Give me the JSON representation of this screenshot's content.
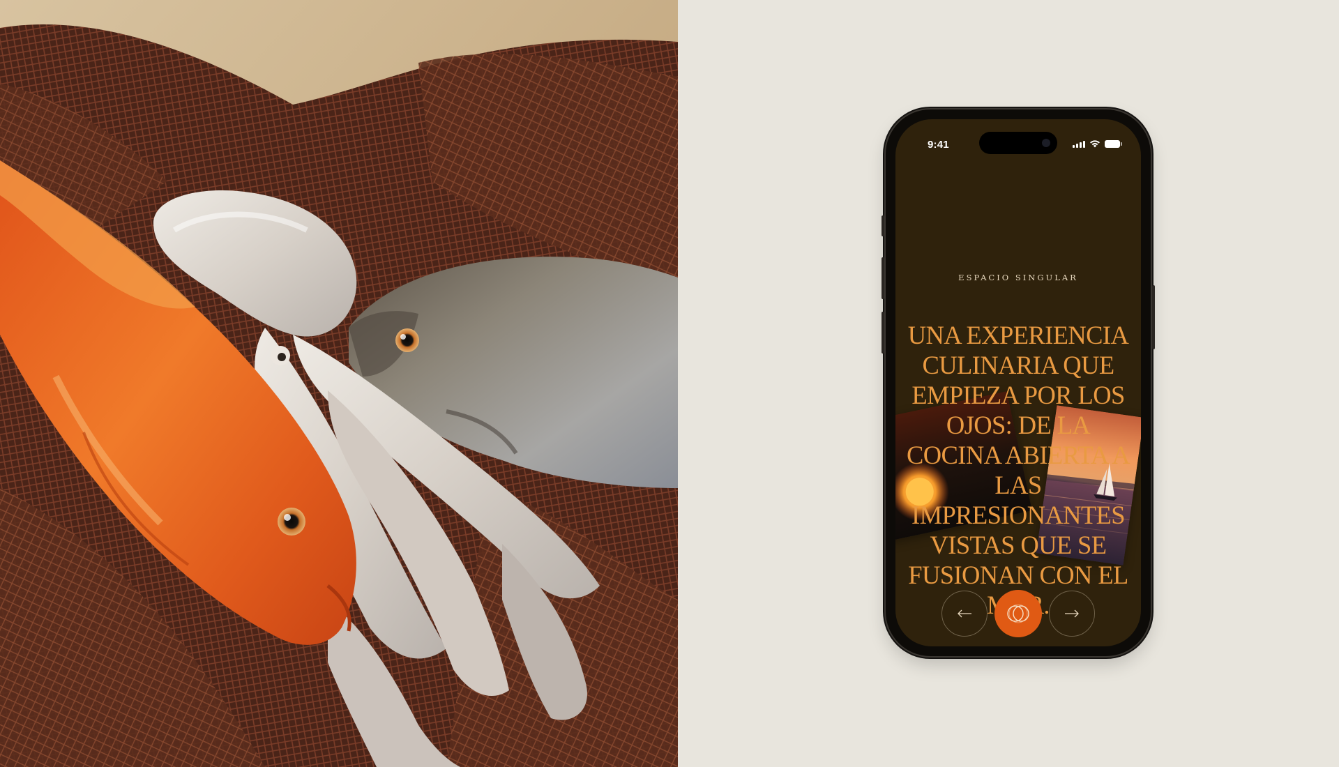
{
  "status_bar": {
    "time": "9:41"
  },
  "app": {
    "brand_title": "ESPACIO SINGULAR",
    "headline": "UNA EXPERIENCIA CULINARIA QUE EMPIEZA POR LOS OJOS: DE LA COCINA ABIERTA A LAS IMPRESIONANTES VISTAS QUE SE FUSIONAN CON EL MAR."
  },
  "navigation": {
    "prev_icon": "arrow-left-icon",
    "home_icon": "interlocking-rings-icon",
    "next_icon": "arrow-right-icon"
  },
  "images": {
    "left_photo": "seafood-on-fishing-net-photo",
    "screen_photo_1": "sunset-photo",
    "screen_photo_2": "sailboat-at-dusk-photo"
  },
  "colors": {
    "page_background": "#e8e5dd",
    "screen_background": "#2f220c",
    "headline": "#e99a42",
    "brand_title": "#e9d9bf",
    "accent_button": "#e05a14"
  }
}
